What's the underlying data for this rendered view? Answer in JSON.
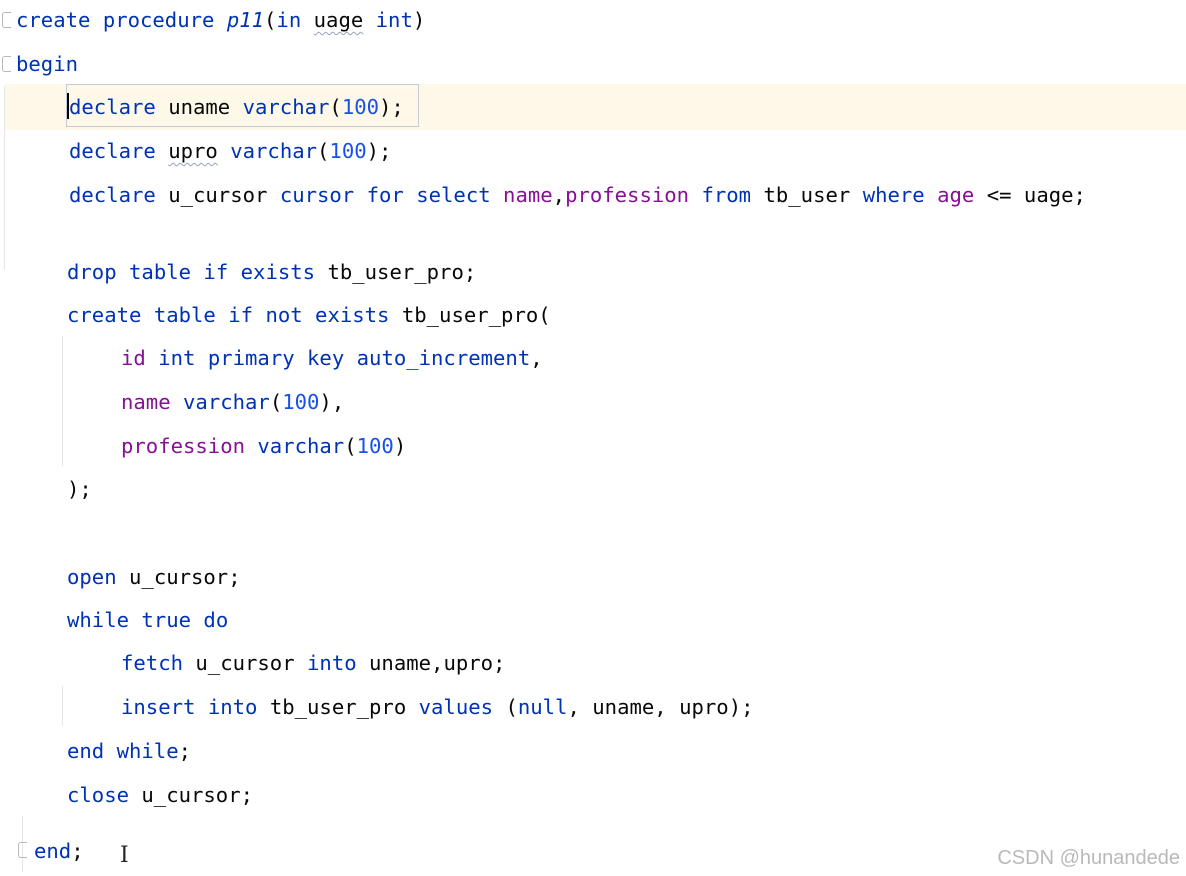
{
  "editor": {
    "language": "SQL",
    "current_line": 3,
    "watermark": "CSDN @hunandede",
    "lines": [
      {
        "n": 1,
        "tokens": [
          {
            "t": "create",
            "c": "kw"
          },
          {
            "t": " ",
            "c": "id"
          },
          {
            "t": "procedure",
            "c": "kw"
          },
          {
            "t": " ",
            "c": "id"
          },
          {
            "t": "p11",
            "c": "ital"
          },
          {
            "t": "(",
            "c": "punct"
          },
          {
            "t": "in",
            "c": "kw"
          },
          {
            "t": " ",
            "c": "id"
          },
          {
            "t": "uage",
            "c": "id squiggle"
          },
          {
            "t": " ",
            "c": "id"
          },
          {
            "t": "int",
            "c": "kw"
          },
          {
            "t": ")",
            "c": "punct"
          }
        ]
      },
      {
        "n": 2,
        "tokens": [
          {
            "t": "begin",
            "c": "kw"
          }
        ]
      },
      {
        "n": 3,
        "tokens": [
          {
            "t": "declare",
            "c": "kw"
          },
          {
            "t": " ",
            "c": "id"
          },
          {
            "t": "uname",
            "c": "id"
          },
          {
            "t": " ",
            "c": "id"
          },
          {
            "t": "varchar",
            "c": "kw"
          },
          {
            "t": "(",
            "c": "punct"
          },
          {
            "t": "100",
            "c": "num"
          },
          {
            "t": ")",
            "c": "punct"
          },
          {
            "t": ";",
            "c": "punct"
          }
        ]
      },
      {
        "n": 4,
        "tokens": [
          {
            "t": "declare",
            "c": "kw"
          },
          {
            "t": " ",
            "c": "id"
          },
          {
            "t": "upro",
            "c": "id squiggle"
          },
          {
            "t": " ",
            "c": "id"
          },
          {
            "t": "varchar",
            "c": "kw"
          },
          {
            "t": "(",
            "c": "punct"
          },
          {
            "t": "100",
            "c": "num"
          },
          {
            "t": ")",
            "c": "punct"
          },
          {
            "t": ";",
            "c": "punct"
          }
        ]
      },
      {
        "n": 5,
        "tokens": [
          {
            "t": "declare",
            "c": "kw"
          },
          {
            "t": " ",
            "c": "id"
          },
          {
            "t": "u_cursor",
            "c": "id"
          },
          {
            "t": " ",
            "c": "id"
          },
          {
            "t": "cursor",
            "c": "kw"
          },
          {
            "t": " ",
            "c": "id"
          },
          {
            "t": "for",
            "c": "kw"
          },
          {
            "t": " ",
            "c": "id"
          },
          {
            "t": "select",
            "c": "kw"
          },
          {
            "t": " ",
            "c": "id"
          },
          {
            "t": "name",
            "c": "col"
          },
          {
            "t": ",",
            "c": "punct"
          },
          {
            "t": "profession",
            "c": "col"
          },
          {
            "t": " ",
            "c": "id"
          },
          {
            "t": "from",
            "c": "kw"
          },
          {
            "t": " ",
            "c": "id"
          },
          {
            "t": "tb_user",
            "c": "id"
          },
          {
            "t": " ",
            "c": "id"
          },
          {
            "t": "where",
            "c": "kw"
          },
          {
            "t": " ",
            "c": "id"
          },
          {
            "t": "age",
            "c": "col"
          },
          {
            "t": " ",
            "c": "id"
          },
          {
            "t": "<=",
            "c": "punct"
          },
          {
            "t": " ",
            "c": "id"
          },
          {
            "t": "uage",
            "c": "id"
          },
          {
            "t": ";",
            "c": "punct"
          }
        ]
      },
      {
        "n": 6,
        "tokens": [
          {
            "t": "drop",
            "c": "kw"
          },
          {
            "t": " ",
            "c": "id"
          },
          {
            "t": "table",
            "c": "kw"
          },
          {
            "t": " ",
            "c": "id"
          },
          {
            "t": "if",
            "c": "kw"
          },
          {
            "t": " ",
            "c": "id"
          },
          {
            "t": "exists",
            "c": "kw"
          },
          {
            "t": " ",
            "c": "id"
          },
          {
            "t": "tb_user_pro",
            "c": "id"
          },
          {
            "t": ";",
            "c": "punct"
          }
        ]
      },
      {
        "n": 7,
        "tokens": [
          {
            "t": "create",
            "c": "kw"
          },
          {
            "t": " ",
            "c": "id"
          },
          {
            "t": "table",
            "c": "kw"
          },
          {
            "t": " ",
            "c": "id"
          },
          {
            "t": "if",
            "c": "kw"
          },
          {
            "t": " ",
            "c": "id"
          },
          {
            "t": "not",
            "c": "kw"
          },
          {
            "t": " ",
            "c": "id"
          },
          {
            "t": "exists",
            "c": "kw"
          },
          {
            "t": " ",
            "c": "id"
          },
          {
            "t": "tb_user_pro",
            "c": "id"
          },
          {
            "t": "(",
            "c": "punct"
          }
        ]
      },
      {
        "n": 8,
        "tokens": [
          {
            "t": "id",
            "c": "col"
          },
          {
            "t": " ",
            "c": "id"
          },
          {
            "t": "int",
            "c": "kw"
          },
          {
            "t": " ",
            "c": "id"
          },
          {
            "t": "primary",
            "c": "kw"
          },
          {
            "t": " ",
            "c": "id"
          },
          {
            "t": "key",
            "c": "kw"
          },
          {
            "t": " ",
            "c": "id"
          },
          {
            "t": "auto_increment",
            "c": "kw"
          },
          {
            "t": ",",
            "c": "punct"
          }
        ]
      },
      {
        "n": 9,
        "tokens": [
          {
            "t": "name",
            "c": "col"
          },
          {
            "t": " ",
            "c": "id"
          },
          {
            "t": "varchar",
            "c": "kw"
          },
          {
            "t": "(",
            "c": "punct"
          },
          {
            "t": "100",
            "c": "num"
          },
          {
            "t": ")",
            "c": "punct"
          },
          {
            "t": ",",
            "c": "punct"
          }
        ]
      },
      {
        "n": 10,
        "tokens": [
          {
            "t": "profession",
            "c": "col"
          },
          {
            "t": " ",
            "c": "id"
          },
          {
            "t": "varchar",
            "c": "kw"
          },
          {
            "t": "(",
            "c": "punct"
          },
          {
            "t": "100",
            "c": "num"
          },
          {
            "t": ")",
            "c": "punct"
          }
        ]
      },
      {
        "n": 11,
        "tokens": [
          {
            "t": ");",
            "c": "punct"
          }
        ]
      },
      {
        "n": 12,
        "tokens": [
          {
            "t": "open",
            "c": "kw"
          },
          {
            "t": " ",
            "c": "id"
          },
          {
            "t": "u_cursor",
            "c": "id"
          },
          {
            "t": ";",
            "c": "punct"
          }
        ]
      },
      {
        "n": 13,
        "tokens": [
          {
            "t": "while",
            "c": "kw"
          },
          {
            "t": " ",
            "c": "id"
          },
          {
            "t": "true",
            "c": "kw"
          },
          {
            "t": " ",
            "c": "id"
          },
          {
            "t": "do",
            "c": "kw"
          }
        ]
      },
      {
        "n": 14,
        "tokens": [
          {
            "t": "fetch",
            "c": "kw"
          },
          {
            "t": " ",
            "c": "id"
          },
          {
            "t": "u_cursor",
            "c": "id"
          },
          {
            "t": " ",
            "c": "id"
          },
          {
            "t": "into",
            "c": "kw"
          },
          {
            "t": " ",
            "c": "id"
          },
          {
            "t": "uname",
            "c": "id"
          },
          {
            "t": ",",
            "c": "punct"
          },
          {
            "t": "upro",
            "c": "id"
          },
          {
            "t": ";",
            "c": "punct"
          }
        ]
      },
      {
        "n": 15,
        "tokens": [
          {
            "t": "insert",
            "c": "kw"
          },
          {
            "t": " ",
            "c": "id"
          },
          {
            "t": "into",
            "c": "kw"
          },
          {
            "t": " ",
            "c": "id"
          },
          {
            "t": "tb_user_pro",
            "c": "id"
          },
          {
            "t": " ",
            "c": "id"
          },
          {
            "t": "values",
            "c": "kw"
          },
          {
            "t": " ",
            "c": "id"
          },
          {
            "t": "(",
            "c": "punct"
          },
          {
            "t": "null",
            "c": "kw"
          },
          {
            "t": ", ",
            "c": "punct"
          },
          {
            "t": "uname",
            "c": "id"
          },
          {
            "t": ", ",
            "c": "punct"
          },
          {
            "t": "upro",
            "c": "id"
          },
          {
            "t": ");",
            "c": "punct"
          }
        ]
      },
      {
        "n": 16,
        "tokens": [
          {
            "t": "end",
            "c": "kw"
          },
          {
            "t": " ",
            "c": "id"
          },
          {
            "t": "while",
            "c": "kw"
          },
          {
            "t": ";",
            "c": "punct"
          }
        ]
      },
      {
        "n": 17,
        "tokens": [
          {
            "t": "close",
            "c": "kw"
          },
          {
            "t": " ",
            "c": "id"
          },
          {
            "t": "u_cursor",
            "c": "id"
          },
          {
            "t": ";",
            "c": "punct"
          }
        ]
      },
      {
        "n": 18,
        "tokens": [
          {
            "t": "end",
            "c": "kw"
          },
          {
            "t": ";",
            "c": "punct"
          }
        ]
      }
    ]
  }
}
